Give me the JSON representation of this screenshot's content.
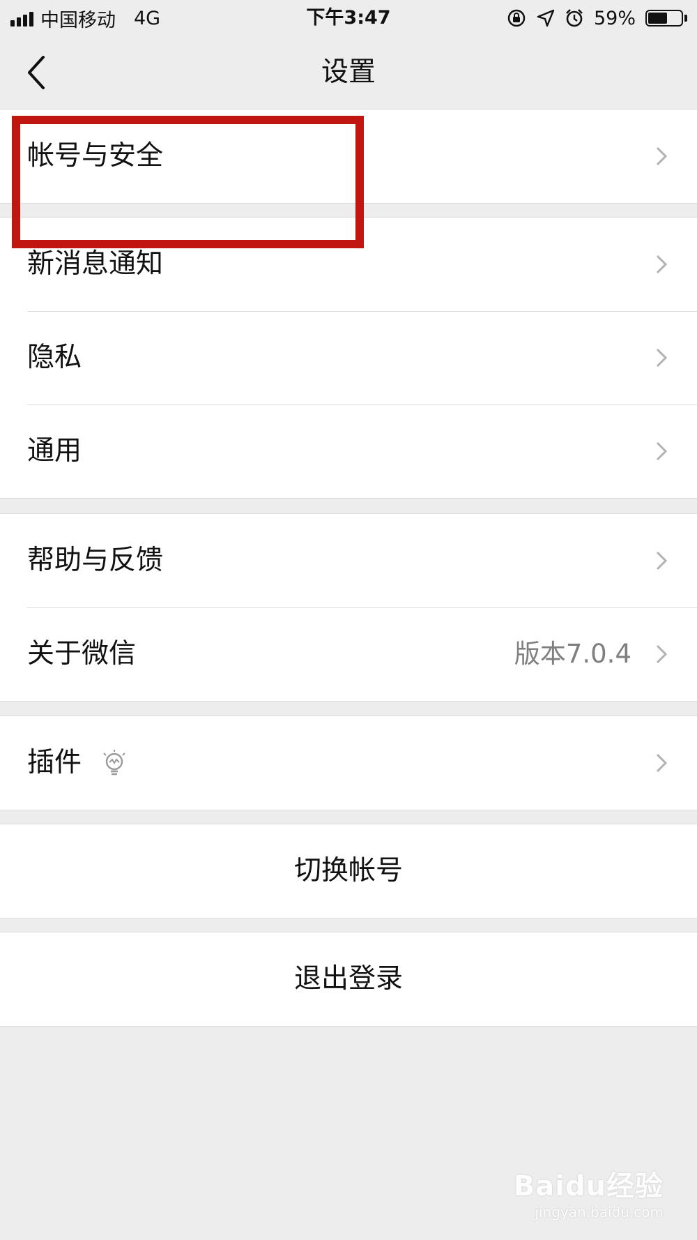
{
  "status_bar": {
    "carrier": "中国移动",
    "network": "4G",
    "time": "下午3:47",
    "battery_percent": "59%",
    "battery_level": 0.59
  },
  "nav": {
    "title": "设置"
  },
  "groups": {
    "account": {
      "items": [
        {
          "label": "帐号与安全"
        }
      ]
    },
    "notifications": {
      "items": [
        {
          "label": "新消息通知"
        },
        {
          "label": "隐私"
        },
        {
          "label": "通用"
        }
      ]
    },
    "help": {
      "items": [
        {
          "label": "帮助与反馈"
        },
        {
          "label": "关于微信",
          "value": "版本7.0.4"
        }
      ]
    },
    "plugins": {
      "items": [
        {
          "label": "插件"
        }
      ]
    }
  },
  "actions": {
    "switch_account": "切换帐号",
    "logout": "退出登录"
  },
  "annotation": {
    "highlight_color": "#c1150f"
  },
  "watermark": {
    "main": "Baidu经验",
    "sub": "jingyan.baidu.com"
  }
}
